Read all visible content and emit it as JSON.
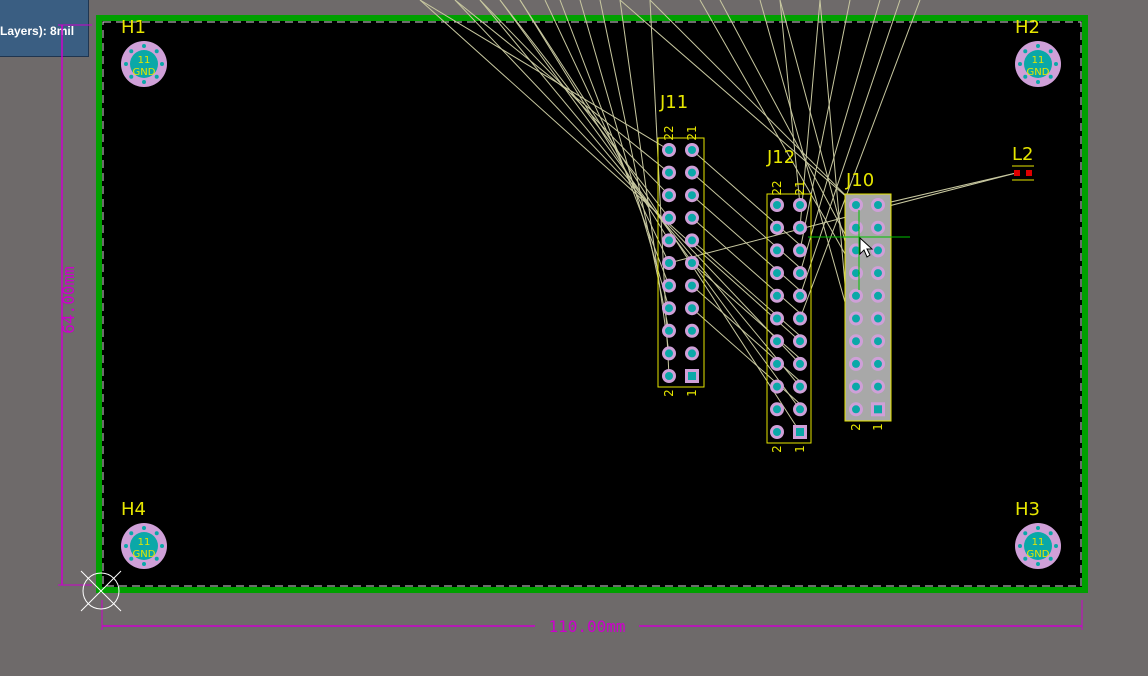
{
  "hud": {
    "rule_text": "Layers): 8mil"
  },
  "board": {
    "width_dim": "110.00mm",
    "height_dim": "64.00mm",
    "colors": {
      "background": "#6e6a6a",
      "board": "#000000",
      "outline": "#00a000",
      "dimension": "#cc00cc",
      "silk": "#e6e600",
      "pad_ring": "#cfa0d8",
      "pad_hole": "#0aa8a8",
      "ratsnest": "#c8c8a0"
    }
  },
  "mounting_holes": [
    {
      "ref": "H1",
      "net": "GND",
      "pin": "11"
    },
    {
      "ref": "H2",
      "net": "GND",
      "pin": "11"
    },
    {
      "ref": "H3",
      "net": "GND",
      "pin": "11"
    },
    {
      "ref": "H4",
      "net": "GND",
      "pin": "11"
    }
  ],
  "connectors": [
    {
      "ref": "J11",
      "pin_top_left": "22",
      "pin_top_right": "21",
      "pin_bottom_left": "2",
      "pin_bottom_right": "1",
      "rows": 11,
      "selected": false
    },
    {
      "ref": "J12",
      "pin_top_left": "22",
      "pin_top_right": "21",
      "pin_bottom_left": "2",
      "pin_bottom_right": "1",
      "rows": 11,
      "selected": false
    },
    {
      "ref": "J10",
      "pin_top_left": "",
      "pin_top_right": "",
      "pin_bottom_left": "2",
      "pin_bottom_right": "1",
      "rows": 10,
      "selected": true
    }
  ],
  "components": [
    {
      "ref": "L2"
    }
  ],
  "icons": {
    "origin": "origin-marker-icon",
    "cursor": "mouse-pointer-icon",
    "crosshair": "crosshair-icon"
  }
}
